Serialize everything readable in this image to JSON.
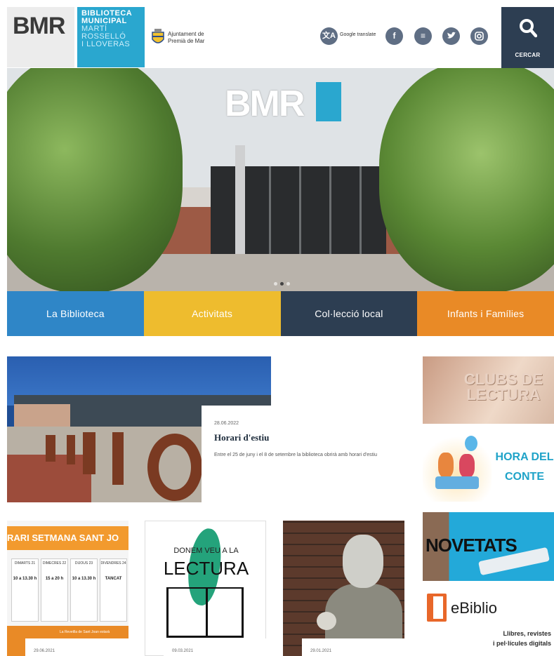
{
  "header": {
    "logo_short": "BMR",
    "logo_lines": [
      "BIBLIOTECA",
      "MUNICIPAL",
      "MARTÍ",
      "ROSSELLÓ",
      "I LLOVERAS"
    ],
    "ajuntament_line1": "Ajuntament de",
    "ajuntament_line2": "Premià de Mar",
    "translate_label": "Google translate",
    "search_label": "CERCAR",
    "social": [
      "facebook",
      "email",
      "twitter",
      "instagram"
    ]
  },
  "hero": {
    "sign_text": "BMR",
    "slide_count": 3,
    "active_slide": 2
  },
  "nav": [
    {
      "label": "La Biblioteca",
      "color": "#2f86c7"
    },
    {
      "label": "Activitats",
      "color": "#eebc2e"
    },
    {
      "label": "Col·lecció local",
      "color": "#2d3e52"
    },
    {
      "label": "Infants i Famílies",
      "color": "#e98a26"
    }
  ],
  "featured": {
    "date": "28.06.2022",
    "title": "Horari d'estiu",
    "description": "Entre el 25 de juny i el 8 de setembre la biblioteca obrirà amb horari d'estiu"
  },
  "sidebar": {
    "clubs": "CLUBS DE LECTURA",
    "hora_line1": "HORA DEL",
    "hora_line2": "CONTE",
    "novetats": "NOVETATS",
    "ebiblio_name": "eBiblio",
    "ebiblio_line1": "Llibres, revistes",
    "ebiblio_line2": "i pel·lícules digitals"
  },
  "cards": [
    {
      "banner": "RARI SETMANA SANT JO",
      "days": [
        "DIMARTS 21",
        "DIMECRES 22",
        "DIJOUS 23",
        "DIVENDRES 24"
      ],
      "hours": [
        "10 a 13.30 h",
        "15 a 20 h",
        "10 a 13.30 h",
        "TANCAT"
      ],
      "note": "La Revetlla de Sant Joan estarà",
      "date": "29.06.2021"
    },
    {
      "line1": "DONEM VEU A LA",
      "line2": "LECTURA",
      "date": "09.03.2021"
    },
    {
      "date": "29.01.2021"
    }
  ],
  "colors": {
    "brand_blue": "#2aa7cf",
    "dark_navy": "#2d3e52",
    "orange": "#e98a26",
    "yellow": "#eebc2e"
  }
}
